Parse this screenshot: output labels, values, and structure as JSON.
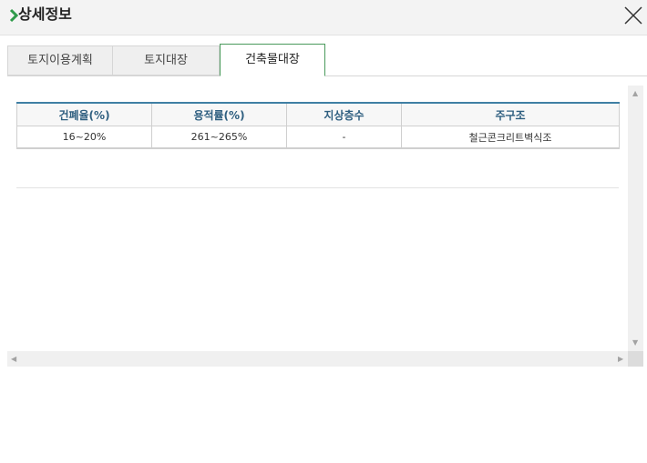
{
  "window": {
    "title": "상세정보"
  },
  "tabs": [
    {
      "label": "토지이용계획",
      "active": false
    },
    {
      "label": "토지대장",
      "active": false
    },
    {
      "label": "건축물대장",
      "active": true
    }
  ],
  "table": {
    "headers": [
      "건폐율(%)",
      "용적률(%)",
      "지상층수",
      "주구조"
    ],
    "rows": [
      [
        "16~20%",
        "261~265%",
        "-",
        "철근콘크리트벽식조"
      ]
    ]
  },
  "colors": {
    "accent_green": "#4a9a5c",
    "table_header_blue": "#2f5f80"
  },
  "icons": {
    "title_marker": "chevron-right-icon",
    "close": "close-icon"
  }
}
